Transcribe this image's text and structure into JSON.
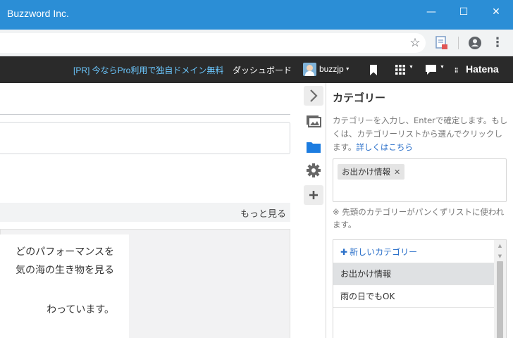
{
  "window": {
    "title": "Buzzword Inc.",
    "controls": {
      "minimize": "—",
      "maximize": "☐",
      "close": "✕"
    }
  },
  "browser": {
    "icons": [
      "star-icon",
      "extension-icon",
      "profile-icon",
      "kebab-menu-icon"
    ]
  },
  "hatena_bar": {
    "promo": "[PR] 今ならPro利用で独自ドメイン無料",
    "dashboard": "ダッシュボード",
    "username": "buzzjp",
    "logo": "Hatena",
    "colors": {
      "background": "#2a2a2a",
      "promo": "#6cc8ff"
    }
  },
  "editor": {
    "more_link": "もっと見る",
    "preview_lines": [
      "どのパフォーマンスを",
      "気の海の生き物を見る",
      "わっています。"
    ]
  },
  "rail": {
    "icons": [
      "chevron-right-icon",
      "image-icon",
      "folder-icon",
      "gear-icon",
      "plus-icon"
    ]
  },
  "category_panel": {
    "title": "カテゴリー",
    "description": "カテゴリーを入力し、Enterで確定します。もしくは、カテゴリーリストから選んでクリックします。",
    "details_link": "詳しくはこちら",
    "selected_tag": "お出かけ情報",
    "note": "※ 先頭のカテゴリーがパンくずリストに使われます。",
    "new_category": "新しいカテゴリー",
    "list": [
      "お出かけ情報",
      "雨の日でもOK"
    ],
    "colors": {
      "link": "#2a6fc9",
      "selected_row": "#dfe1e3"
    }
  }
}
